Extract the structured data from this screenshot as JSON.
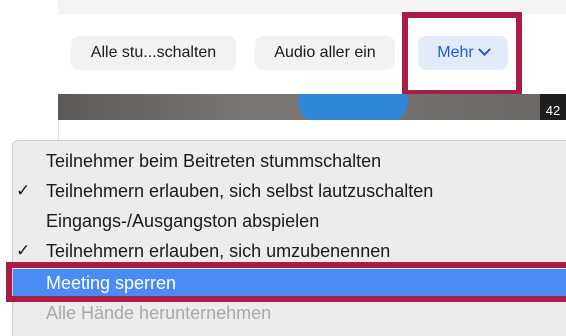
{
  "toolbar": {
    "mute_all_label": "Alle stu...schalten",
    "unmute_all_label": "Audio aller ein",
    "more_label": "Mehr"
  },
  "video_strip": {
    "corner_number": "42"
  },
  "menu": {
    "items": [
      {
        "label": "Teilnehmer beim Beitreten stummschalten",
        "checked": false,
        "check_glyph": "",
        "state": "normal"
      },
      {
        "label": "Teilnehmern erlauben, sich selbst lautzuschalten",
        "checked": true,
        "check_glyph": "✓",
        "state": "normal"
      },
      {
        "label": "Eingangs-/Ausgangston abspielen",
        "checked": false,
        "check_glyph": "",
        "state": "normal"
      },
      {
        "label": "Teilnehmern erlauben, sich umzubenennen",
        "checked": true,
        "check_glyph": "✓",
        "state": "normal"
      },
      {
        "label": "Meeting sperren",
        "checked": false,
        "check_glyph": "",
        "state": "selected"
      },
      {
        "label": "Alle Hände herunternehmen",
        "checked": false,
        "check_glyph": "",
        "state": "disabled"
      }
    ]
  },
  "colors": {
    "highlight": "#a81c45",
    "selection": "#4a8bf5",
    "more_button_text": "#1a5de0"
  }
}
